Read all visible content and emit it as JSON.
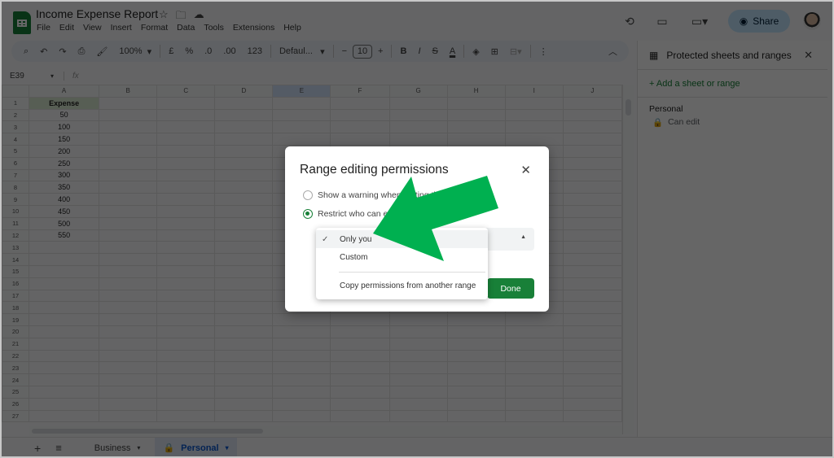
{
  "app": {
    "doc_title": "Income Expense Report",
    "title_icons": [
      "star-icon",
      "move-to-folder-icon",
      "cloud-saved-icon"
    ],
    "menu": [
      "File",
      "Edit",
      "View",
      "Insert",
      "Format",
      "Data",
      "Tools",
      "Extensions",
      "Help"
    ],
    "share_label": "Share",
    "brand_color": "#188038"
  },
  "toolbar": {
    "zoom": "100%",
    "currency": "£",
    "percent": "%",
    "dec_decrease": ".0",
    "dec_increase": ".00",
    "number_format": "123",
    "font": "Defaul...",
    "font_size": "10",
    "minus": "−",
    "plus": "+",
    "bold": "B",
    "italic": "I",
    "strike": "S",
    "text_color": "A"
  },
  "formula_bar": {
    "cell_ref": "E39",
    "fx": "fx",
    "value": ""
  },
  "grid": {
    "columns": [
      "A",
      "B",
      "C",
      "D",
      "E",
      "F",
      "G",
      "H",
      "I",
      "J"
    ],
    "selected_column": "E",
    "rows": [
      [
        "Expense"
      ],
      [
        "50"
      ],
      [
        "100"
      ],
      [
        "150"
      ],
      [
        "200"
      ],
      [
        "250"
      ],
      [
        "300"
      ],
      [
        "350"
      ],
      [
        "400"
      ],
      [
        "450"
      ],
      [
        "500"
      ],
      [
        "550"
      ],
      [],
      [],
      [],
      [],
      [],
      [],
      [],
      [],
      [],
      [],
      [],
      [],
      [],
      [],
      []
    ]
  },
  "sheets": {
    "tabs": [
      {
        "label": "Business",
        "active": false,
        "locked": false
      },
      {
        "label": "Personal",
        "active": true,
        "locked": true
      }
    ]
  },
  "panel": {
    "title": "Protected sheets and ranges",
    "add_label": "+ Add a sheet or range",
    "items": [
      {
        "name": "Personal",
        "description": "Can edit"
      }
    ]
  },
  "dialog": {
    "title": "Range editing permissions",
    "option_warning": "Show a warning when editing this range",
    "option_restrict": "Restrict who can edit this range",
    "selected_option": "restrict",
    "done_label": "Done",
    "dropdown": {
      "options": [
        "Only you",
        "Custom",
        "Copy permissions from another range"
      ],
      "selected": "Only you"
    }
  },
  "annotation": {
    "arrow_color": "#00b050"
  }
}
